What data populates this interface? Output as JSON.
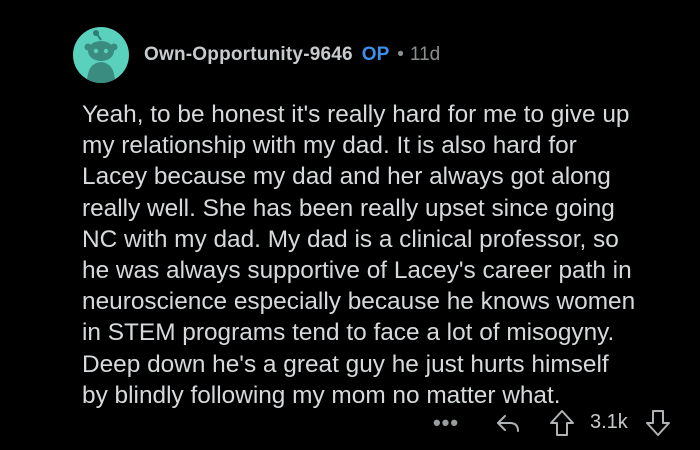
{
  "comment": {
    "username": "Own-Opportunity-9646",
    "op_badge": "OP",
    "separator": "•",
    "age": "11d",
    "body": "Yeah, to be honest it's really hard for me to give up\nmy relationship with my dad. It is also hard for\nLacey because my dad and her always got along\nreally well. She has been really upset since going\nNC with my dad. My dad is a clinical professor, so\nhe was always supportive of Lacey's career path in\nneuroscience especially because he knows women\nin STEM programs tend to face a lot of misogyny.\nDeep down he's a great guy he just hurts himself\nby blindly following my mom no matter what.",
    "score": "3.1k"
  },
  "actions": {
    "more": "•••",
    "reply_icon": "reply-arrow-icon",
    "upvote_icon": "upvote-arrow-icon",
    "downvote_icon": "downvote-arrow-icon"
  },
  "colors": {
    "background": "#000000",
    "text": "#d7dadc",
    "op_badge": "#3d8fe8",
    "avatar_bg": "#5ad1bd",
    "muted": "#8b8e90"
  }
}
